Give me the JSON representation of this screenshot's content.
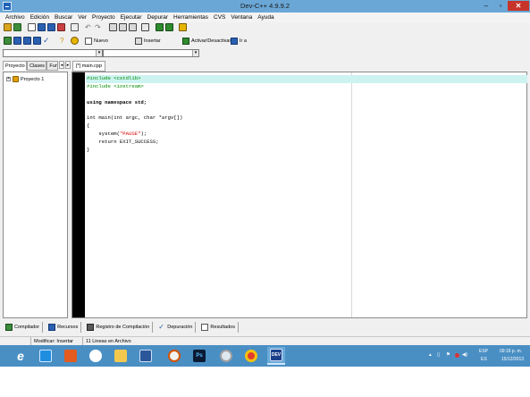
{
  "window": {
    "title": "Dev-C++ 4.9.9.2",
    "controls": {
      "minimize": "–",
      "maximize": "▫",
      "close": "✕"
    }
  },
  "menubar": {
    "items": [
      "Archivo",
      "Edición",
      "Buscar",
      "Ver",
      "Proyecto",
      "Ejecutar",
      "Depurar",
      "Herramientas",
      "CVS",
      "Ventana",
      "Ayuda"
    ]
  },
  "toolbar": {
    "new_label": "Nuevo",
    "insert_label": "Insertar",
    "toggle_label": "Activar/Desactivar",
    "goto_label": "Ir a"
  },
  "combos": {
    "class_value": "",
    "member_value": ""
  },
  "left_panel": {
    "tabs": [
      "Proyecto",
      "Clases",
      "Funcio"
    ],
    "tree": {
      "expander": "+",
      "project_label": "Proyecto 1"
    }
  },
  "editor": {
    "tabs": [
      "[*] main.cpp"
    ],
    "lines": [
      {
        "text": "#include <cstdlib>",
        "kind": "pp",
        "highlight": true
      },
      {
        "text": "#include <iostream>",
        "kind": "pp",
        "highlight": false
      },
      {
        "text": "",
        "kind": "plain",
        "highlight": false
      },
      {
        "text": "using namespace std;",
        "kind": "kw",
        "highlight": false
      },
      {
        "text": "",
        "kind": "plain",
        "highlight": false
      },
      {
        "text": "int main(int argc, char *argv[])",
        "kind": "plain",
        "highlight": false
      },
      {
        "text": "{",
        "kind": "plain",
        "highlight": false
      },
      {
        "text": "    system(\"PAUSE\");",
        "kind": "str",
        "highlight": false,
        "pre": "    system(",
        "str": "\"PAUSE\"",
        "post": ");"
      },
      {
        "text": "    return EXIT_SUCCESS;",
        "kind": "plain",
        "highlight": false
      },
      {
        "text": "}",
        "kind": "plain",
        "highlight": false
      }
    ]
  },
  "bottom_tabs": [
    {
      "label": "Compilador",
      "icon": "grid-icon"
    },
    {
      "label": "Recursos",
      "icon": "resources-icon"
    },
    {
      "label": "Registro de Compilación",
      "icon": "log-icon"
    },
    {
      "label": "Depuración",
      "icon": "check-icon"
    },
    {
      "label": "Resultados",
      "icon": "results-icon"
    }
  ],
  "statusbar": {
    "mode": "Modificar: Insertar",
    "lines": "11 Lineas en Archivo"
  },
  "taskbar": {
    "icons": [
      "ie-icon",
      "store-icon",
      "office-icon",
      "media-icon",
      "folder-icon",
      "docs-icon",
      "slides-icon",
      "photoshop-icon",
      "disc-icon",
      "chrome-icon",
      "devcpp-icon"
    ],
    "ps_label": "Ps",
    "devcpp_label": "DEV",
    "tray": {
      "lang_top": "ESP",
      "lang_bottom": "ES",
      "time": "09:16 p. m.",
      "date": "15/12/2013"
    }
  },
  "colors": {
    "titlebar": "#6aa7d6",
    "close": "#c7342a",
    "taskbar": "#4a8fc4",
    "highlight_line": "#cdf3f1",
    "preprocessor": "#008b00",
    "string": "#d40000"
  }
}
